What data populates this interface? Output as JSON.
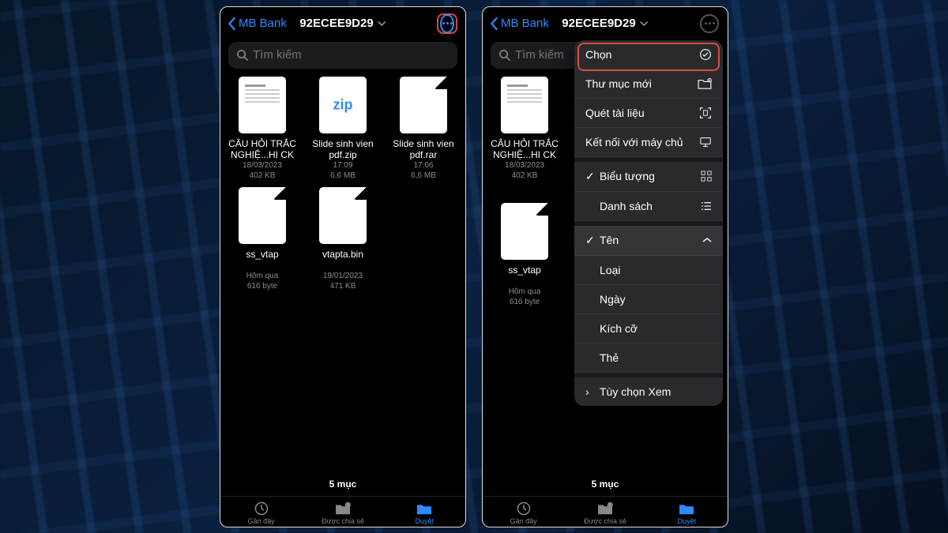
{
  "nav": {
    "back_label": "MB Bank",
    "title": "92ECEE9D29"
  },
  "search": {
    "placeholder": "Tìm kiếm"
  },
  "files": [
    {
      "name": "CÂU HỎI TRẮC NGHIỆ...HI CK",
      "date": "18/03/2023",
      "size": "402 KB",
      "type": "doc"
    },
    {
      "name": "Slide sinh vien pdf.zip",
      "date": "17:09",
      "size": "6,6 MB",
      "type": "zip"
    },
    {
      "name": "Slide sinh vien pdf.rar",
      "date": "17:06",
      "size": "6,6 MB",
      "type": "blank"
    },
    {
      "name": "ss_vtap",
      "date": "Hôm qua",
      "size": "616 byte",
      "type": "blank"
    },
    {
      "name": "vtapta.bin",
      "date": "19/01/2023",
      "size": "471 KB",
      "type": "blank"
    }
  ],
  "files2": [
    {
      "name": "CÂU HỎI TRẮC NGHIỆ...HI CK",
      "date": "18/03/2023",
      "size": "402 KB",
      "type": "doc"
    },
    {
      "name": "ss_vtap",
      "date": "Hôm qua",
      "size": "616 byte",
      "type": "blank"
    }
  ],
  "footer_count": "5 mục",
  "tabs": {
    "recent": "Gần đây",
    "shared": "Được chia sẻ",
    "browse": "Duyệt"
  },
  "menu": {
    "select": "Chọn",
    "new_folder": "Thư mục mới",
    "scan": "Quét tài liệu",
    "connect": "Kết nối với máy chủ",
    "icon_view": "Biểu tượng",
    "list_view": "Danh sách",
    "sort_name": "Tên",
    "sort_kind": "Loại",
    "sort_date": "Ngày",
    "sort_size": "Kích cỡ",
    "sort_tag": "Thẻ",
    "view_options": "Tùy chọn Xem"
  }
}
